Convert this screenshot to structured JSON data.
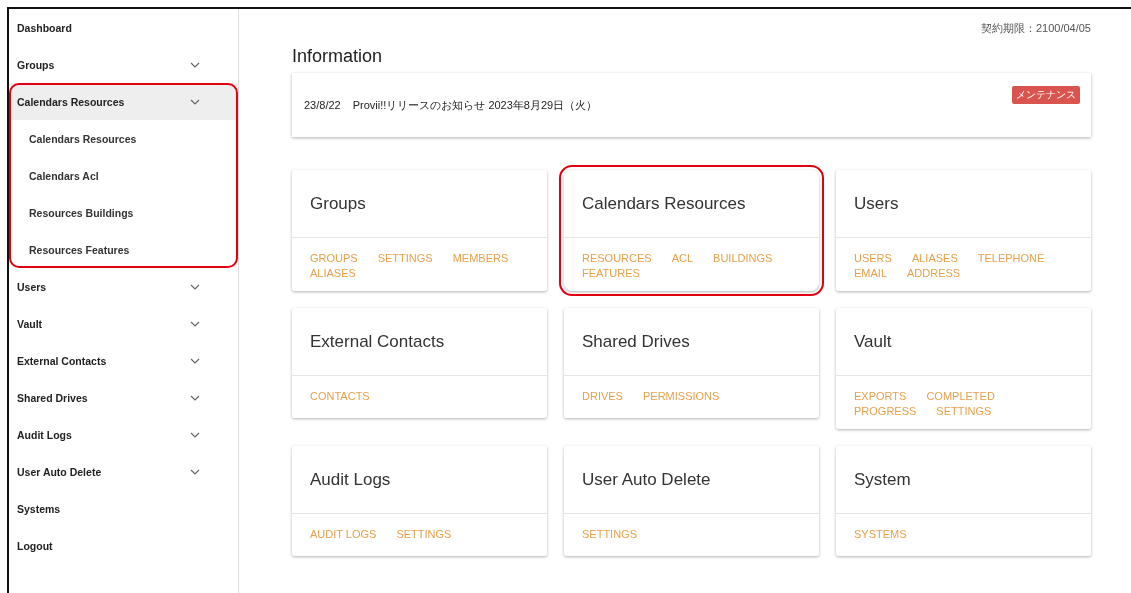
{
  "sidebar": {
    "items": [
      {
        "label": "Dashboard",
        "expandable": false,
        "expanded": false,
        "highlighted": false
      },
      {
        "label": "Groups",
        "expandable": true,
        "expanded": false,
        "highlighted": false
      },
      {
        "label": "Calendars Resources",
        "expandable": true,
        "expanded": true,
        "highlighted": true,
        "children": [
          {
            "label": "Calendars Resources"
          },
          {
            "label": "Calendars Acl"
          },
          {
            "label": "Resources Buildings"
          },
          {
            "label": "Resources Features"
          }
        ]
      },
      {
        "label": "Users",
        "expandable": true,
        "expanded": false,
        "highlighted": false
      },
      {
        "label": "Vault",
        "expandable": true,
        "expanded": false,
        "highlighted": false
      },
      {
        "label": "External Contacts",
        "expandable": true,
        "expanded": false,
        "highlighted": false
      },
      {
        "label": "Shared Drives",
        "expandable": true,
        "expanded": false,
        "highlighted": false
      },
      {
        "label": "Audit Logs",
        "expandable": true,
        "expanded": false,
        "highlighted": false
      },
      {
        "label": "User Auto Delete",
        "expandable": true,
        "expanded": false,
        "highlighted": false
      },
      {
        "label": "Systems",
        "expandable": false,
        "expanded": false,
        "highlighted": false
      },
      {
        "label": "Logout",
        "expandable": false,
        "expanded": false,
        "highlighted": false
      }
    ]
  },
  "contract": "契約期限：2100/04/05",
  "information": {
    "title": "Information",
    "notices": [
      {
        "date": "23/8/22",
        "text": "Provii!!リリースのお知らせ 2023年8月29日（火）",
        "badge": "メンテナンス"
      }
    ]
  },
  "cards": [
    {
      "title": "Groups",
      "highlighted": false,
      "links": [
        "GROUPS",
        "SETTINGS",
        "MEMBERS",
        "ALIASES"
      ]
    },
    {
      "title": "Calendars Resources",
      "highlighted": true,
      "links": [
        "RESOURCES",
        "ACL",
        "BUILDINGS",
        "FEATURES"
      ]
    },
    {
      "title": "Users",
      "highlighted": false,
      "links": [
        "USERS",
        "ALIASES",
        "TELEPHONE",
        "EMAIL",
        "ADDRESS"
      ]
    },
    {
      "title": "External Contacts",
      "highlighted": false,
      "links": [
        "CONTACTS"
      ]
    },
    {
      "title": "Shared Drives",
      "highlighted": false,
      "links": [
        "DRIVES",
        "PERMISSIONS"
      ]
    },
    {
      "title": "Vault",
      "highlighted": false,
      "links": [
        "EXPORTS",
        "COMPLETED",
        "PROGRESS",
        "SETTINGS"
      ]
    },
    {
      "title": "Audit Logs",
      "highlighted": false,
      "links": [
        "AUDIT LOGS",
        "SETTINGS"
      ]
    },
    {
      "title": "User Auto Delete",
      "highlighted": false,
      "links": [
        "SETTINGS"
      ]
    },
    {
      "title": "System",
      "highlighted": false,
      "links": [
        "SYSTEMS"
      ]
    }
  ]
}
